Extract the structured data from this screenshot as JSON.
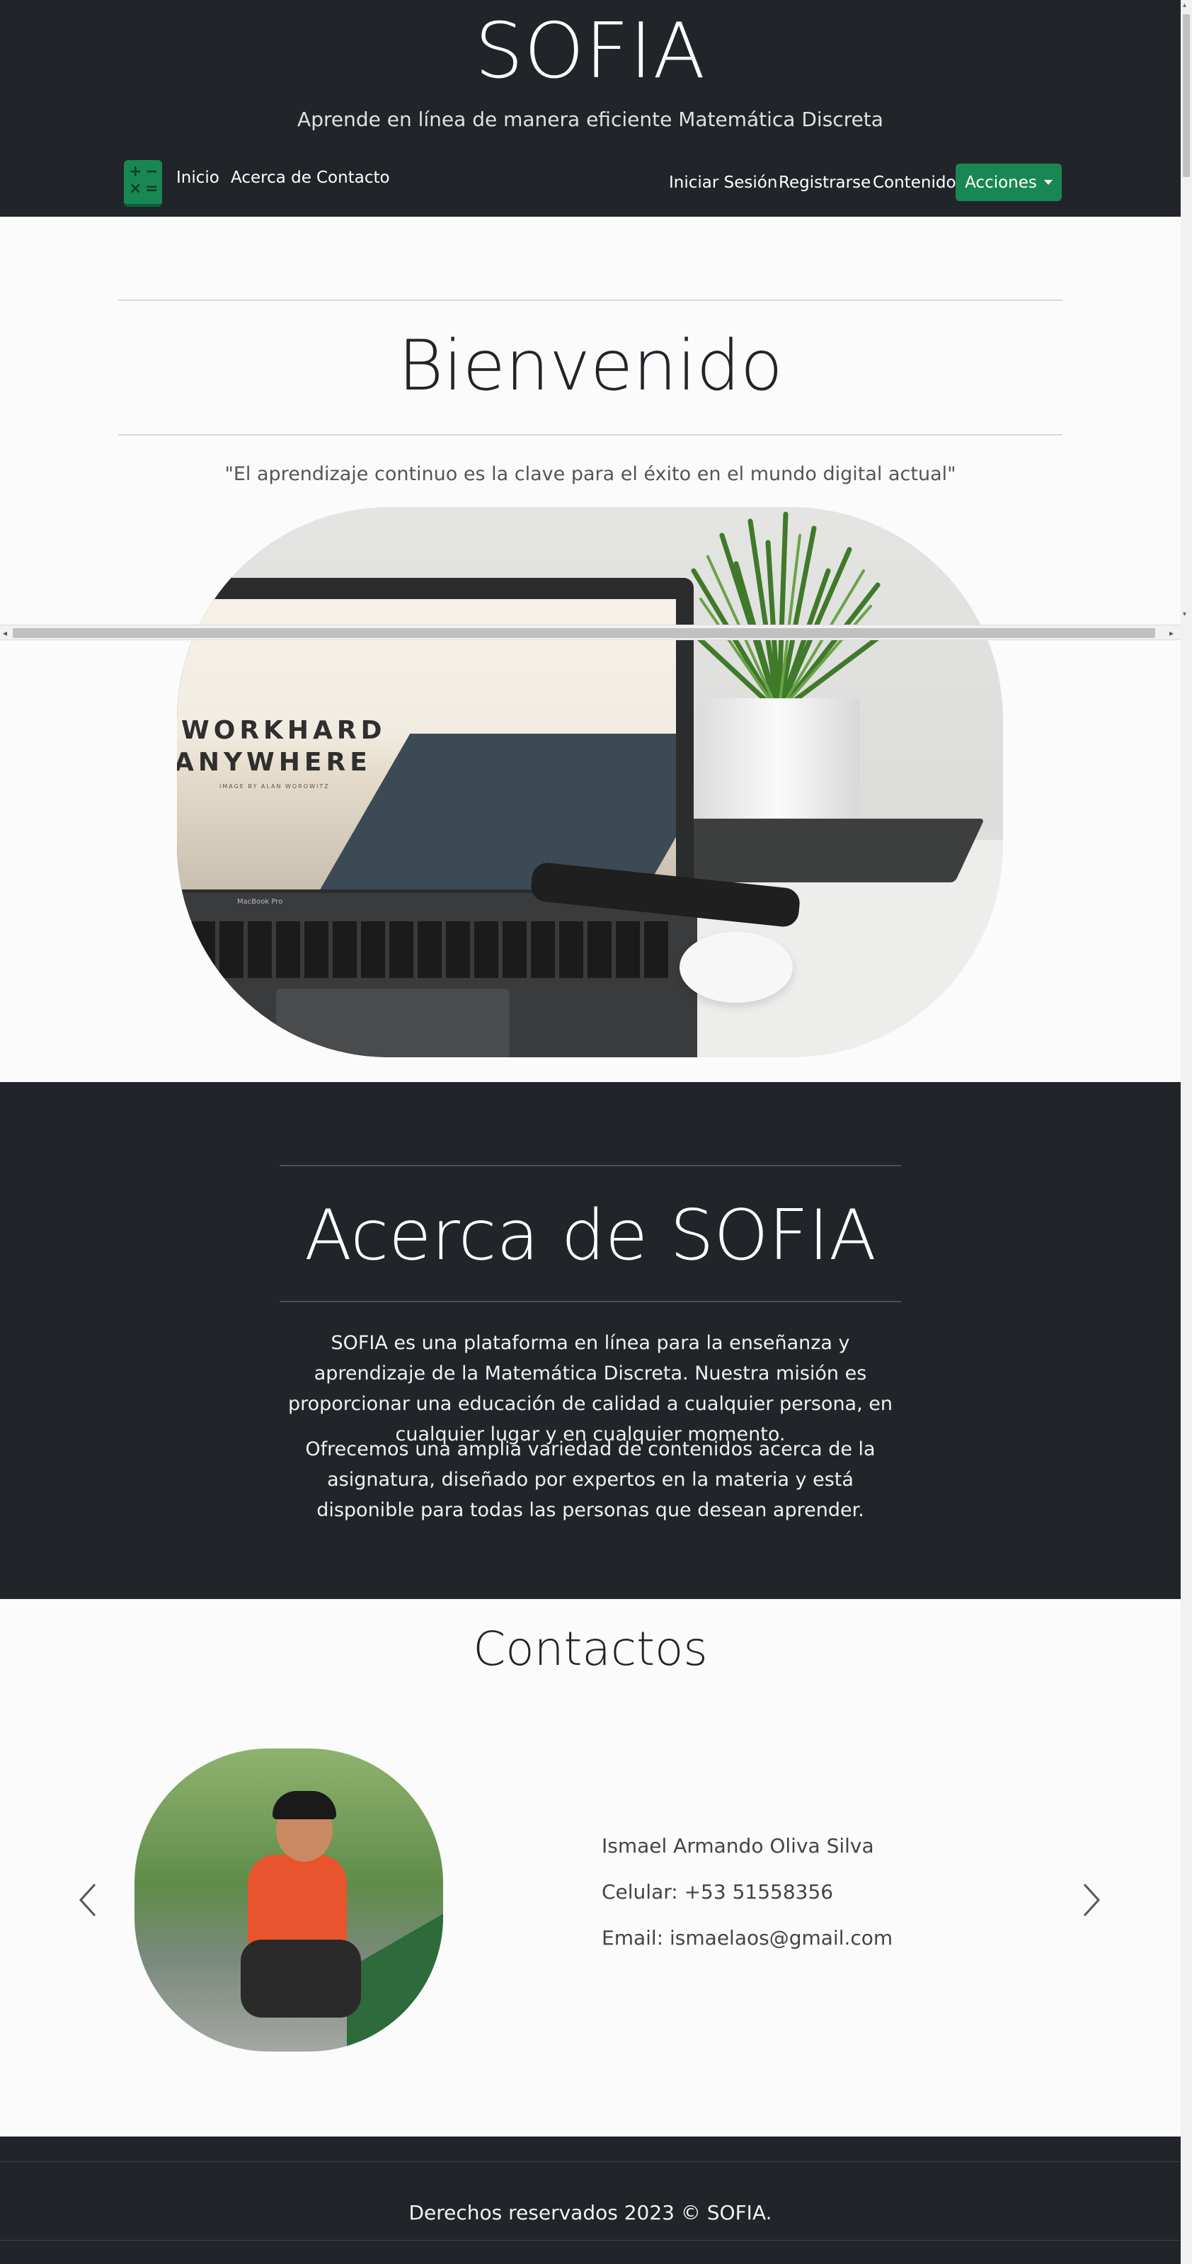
{
  "header": {
    "title": "SOFIA",
    "subtitle": "Aprende en línea de manera eficiente Matemática Discreta",
    "logo_glyphs": [
      "+",
      "−",
      "×",
      "="
    ],
    "nav_left": [
      "Inicio",
      "Acerca de",
      "Contacto"
    ],
    "nav_right": [
      "Iniciar Sesión",
      "Registrarse",
      "Contenido"
    ],
    "actions_label": "Acciones",
    "accent_color": "#198754",
    "background_color": "#212529"
  },
  "welcome": {
    "title": "Bienvenido",
    "quote": "\"El aprendizaje continuo es la clave para el éxito en el mundo digital actual\"",
    "image_text_line1": "WORKHARD",
    "image_text_line2": "ANYWHERE",
    "image_text_small": "IMAGE BY ALAN WOROWITZ",
    "image_laptop_label": "MacBook Pro"
  },
  "about": {
    "title": "Acerca de SOFIA",
    "paragraph1": "SOFIA es una plataforma en línea para la enseñanza y aprendizaje de la Matemática Discreta. Nuestra misión es proporcionar una educación de calidad a cualquier persona, en cualquier lugar y en cualquier momento.",
    "paragraph2": "Ofrecemos una amplia variedad de contenidos acerca de la asignatura, diseñado por expertos en la materia y está disponible para todas las personas que desean aprender."
  },
  "contacts": {
    "title": "Contactos",
    "name": "Ismael Armando Oliva Silva",
    "phone": "Celular: +53 51558356",
    "email": "Email: ismaelaos@gmail.com"
  },
  "footer": {
    "text": "Derechos reservados 2023 © SOFIA."
  }
}
